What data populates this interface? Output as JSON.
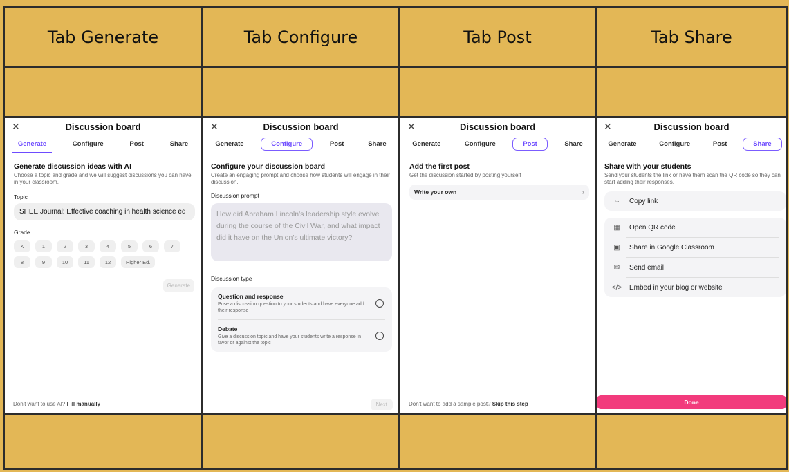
{
  "columns": [
    {
      "heading": "Tab Generate"
    },
    {
      "heading": "Tab Configure"
    },
    {
      "heading": "Tab Post"
    },
    {
      "heading": "Tab Share"
    }
  ],
  "modal": {
    "title": "Discussion board",
    "close_icon": "close-icon",
    "tabs": [
      "Generate",
      "Configure",
      "Post",
      "Share"
    ]
  },
  "generate": {
    "title": "Generate discussion ideas with AI",
    "subtitle": "Choose a topic and grade and we will suggest discussions you can have in your classroom.",
    "topic_label": "Topic",
    "topic_value": "SHEE Journal: Effective coaching in health science ed",
    "grade_label": "Grade",
    "grades": [
      "K",
      "1",
      "2",
      "3",
      "4",
      "5",
      "6",
      "7",
      "8",
      "9",
      "10",
      "11",
      "12",
      "Higher Ed."
    ],
    "generate_button": "Generate",
    "footer_text": "Don't want to use AI?",
    "footer_link": "Fill manually"
  },
  "configure": {
    "title": "Configure your discussion board",
    "subtitle": "Create an engaging prompt and choose how students will engage in their discussion.",
    "prompt_label": "Discussion prompt",
    "prompt_value": "How did Abraham Lincoln's leadership style evolve during the course of the Civil War, and what impact did it have on the Union's ultimate victory?",
    "type_label": "Discussion type",
    "options": [
      {
        "title": "Question and response",
        "desc": "Pose a discussion question to your students and have everyone add their response"
      },
      {
        "title": "Debate",
        "desc": "Give a discussion topic and have your students write a response in favor or against the topic"
      }
    ],
    "next_button": "Next"
  },
  "post": {
    "title": "Add the first post",
    "subtitle": "Get the discussion started by posting yourself",
    "write_own": "Write your own",
    "footer_text": "Don't want to add a sample post?",
    "footer_link": "Skip this step"
  },
  "share": {
    "title": "Share with your students",
    "subtitle": "Send your students the link or have them scan the QR code so they can start adding their responses.",
    "copy_link": "Copy link",
    "items": [
      {
        "label": "Open QR code",
        "icon": "qr-code-icon"
      },
      {
        "label": "Share in Google Classroom",
        "icon": "classroom-icon"
      },
      {
        "label": "Send email",
        "icon": "email-icon"
      },
      {
        "label": "Embed in your blog or website",
        "icon": "code-icon"
      }
    ],
    "done_button": "Done"
  },
  "colors": {
    "background": "#e3b756",
    "accent": "#6e4cff",
    "done": "#f23b7c"
  }
}
